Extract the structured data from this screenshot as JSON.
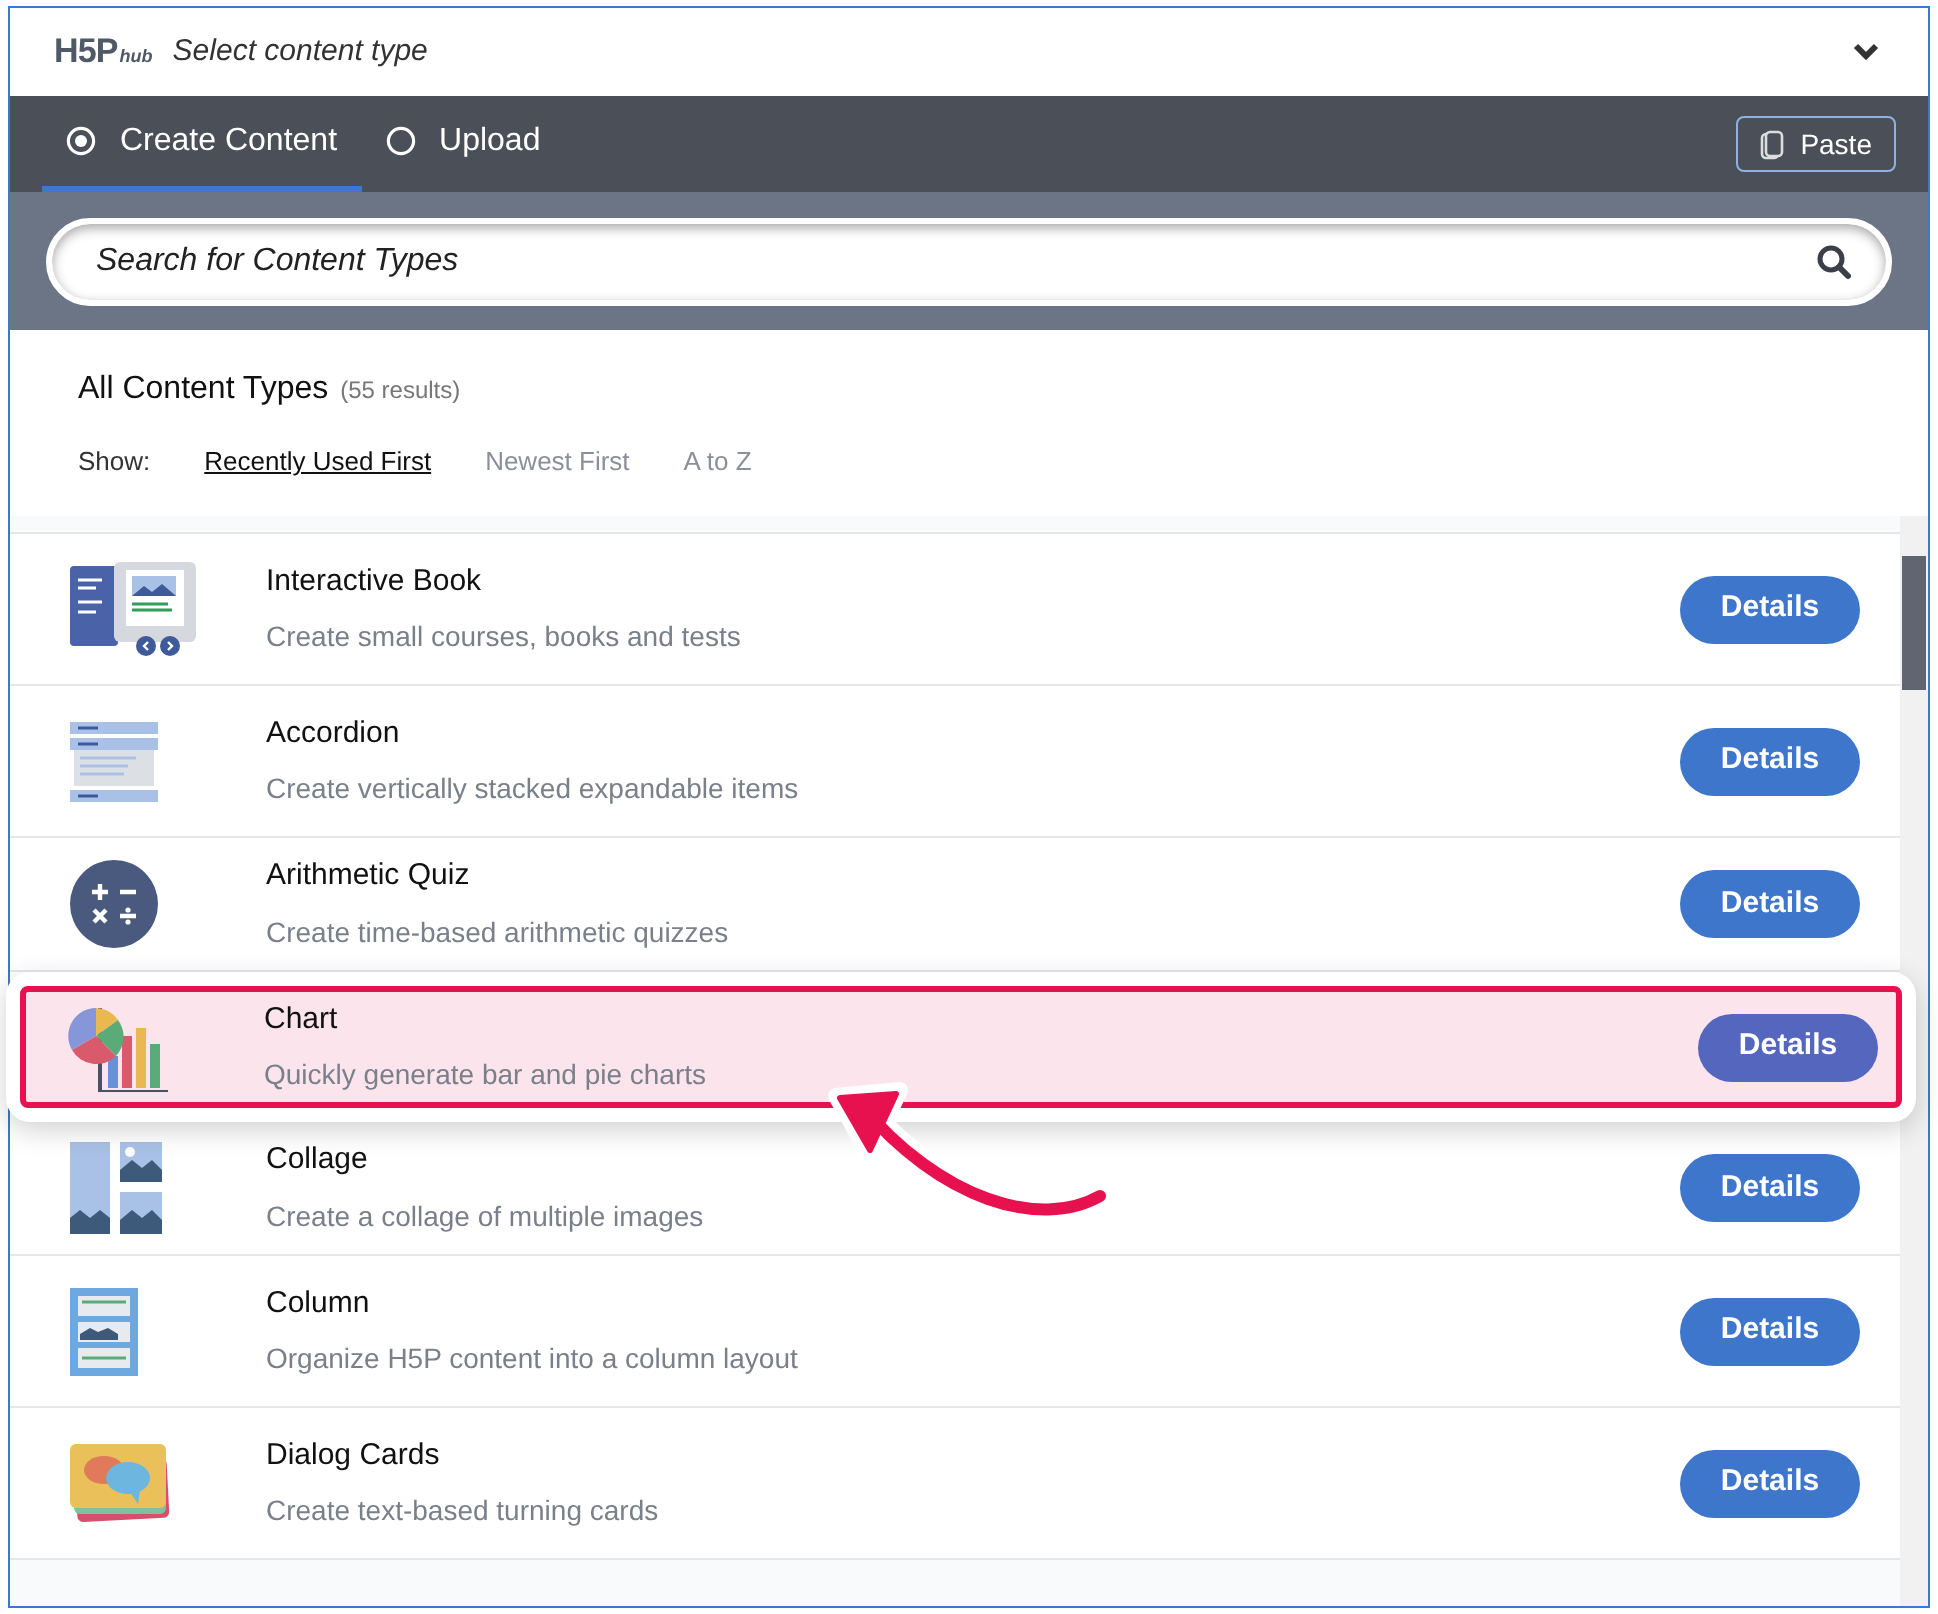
{
  "header": {
    "logo": "H5P",
    "logo_suffix": "hub",
    "title": "Select content type",
    "expanded": true
  },
  "tabs": [
    {
      "label": "Create Content",
      "selected": true
    },
    {
      "label": "Upload",
      "selected": false
    }
  ],
  "paste_button": "Paste",
  "search": {
    "placeholder": "Search for Content Types"
  },
  "list_header": {
    "title": "All Content Types",
    "count": "(55 results)",
    "show_label": "Show:"
  },
  "sort_options": [
    {
      "label": "Recently Used First",
      "selected": true
    },
    {
      "label": "Newest First",
      "selected": false
    },
    {
      "label": "A to Z",
      "selected": false
    }
  ],
  "content_types": [
    {
      "title": "Interactive Book",
      "description": "Create small courses, books and tests",
      "button": "Details",
      "highlighted": false
    },
    {
      "title": "Accordion",
      "description": "Create vertically stacked expandable items",
      "button": "Details",
      "highlighted": false
    },
    {
      "title": "Arithmetic Quiz",
      "description": "Create time-based arithmetic quizzes",
      "button": "Details",
      "highlighted": false
    },
    {
      "title": "Chart",
      "description": "Quickly generate bar and pie charts",
      "button": "Details",
      "highlighted": true
    },
    {
      "title": "Collage",
      "description": "Create a collage of multiple images",
      "button": "Details",
      "highlighted": false
    },
    {
      "title": "Column",
      "description": "Organize H5P content into a column layout",
      "button": "Details",
      "highlighted": false
    },
    {
      "title": "Dialog Cards",
      "description": "Create text-based turning cards",
      "button": "Details",
      "highlighted": false
    }
  ]
}
